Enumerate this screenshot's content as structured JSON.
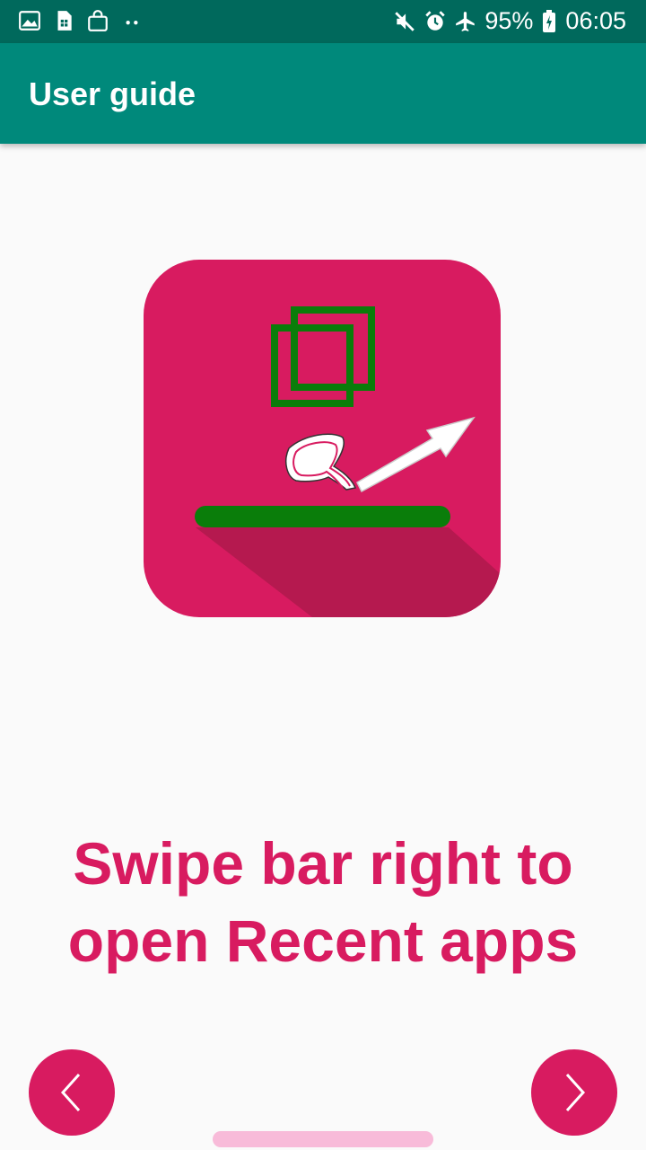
{
  "status_bar": {
    "battery": "95%",
    "time": "06:05",
    "icons": [
      "gallery-icon",
      "sim-icon",
      "shopping-bag-icon",
      "more-dots-icon",
      "mute-icon",
      "alarm-icon",
      "airplane-mode-icon",
      "battery-charging-icon"
    ]
  },
  "app_bar": {
    "title": "User guide"
  },
  "guide": {
    "illustration_icon": "swipe-recent-apps-icon",
    "line1": "Swipe bar right to",
    "line2": "open Recent apps"
  },
  "navigation": {
    "prev_icon": "chevron-left-icon",
    "next_icon": "chevron-right-icon"
  },
  "colors": {
    "status_bar": "#00695c",
    "app_bar": "#00897b",
    "accent": "#d81b60",
    "bar_green": "#0a7d0a",
    "home_indicator": "#f8bbd9"
  }
}
